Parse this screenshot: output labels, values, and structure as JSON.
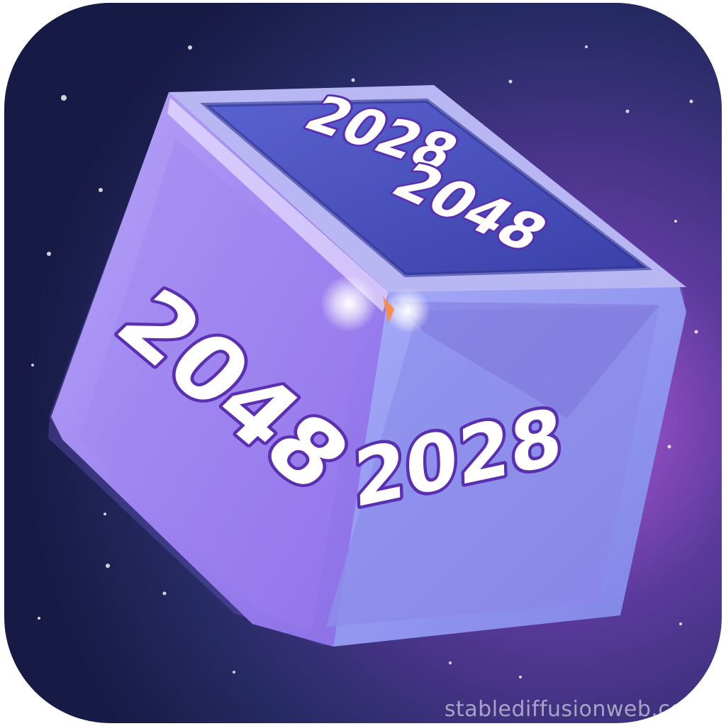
{
  "icon": {
    "name": "2048 cube app icon",
    "faces": {
      "left": "2048",
      "right": "2028",
      "top": [
        "2028",
        "2048"
      ]
    }
  },
  "watermark": "stablediffusionweb.com",
  "colors": {
    "background_dark": "#1b1f4a",
    "background_glow": "#b45ad8",
    "cube_left": "#9f86f0",
    "cube_right": "#8c8cf0",
    "cube_top": "#3f48b8",
    "text_fill": "#ffffff",
    "text_outline": "#5a2fb0"
  }
}
